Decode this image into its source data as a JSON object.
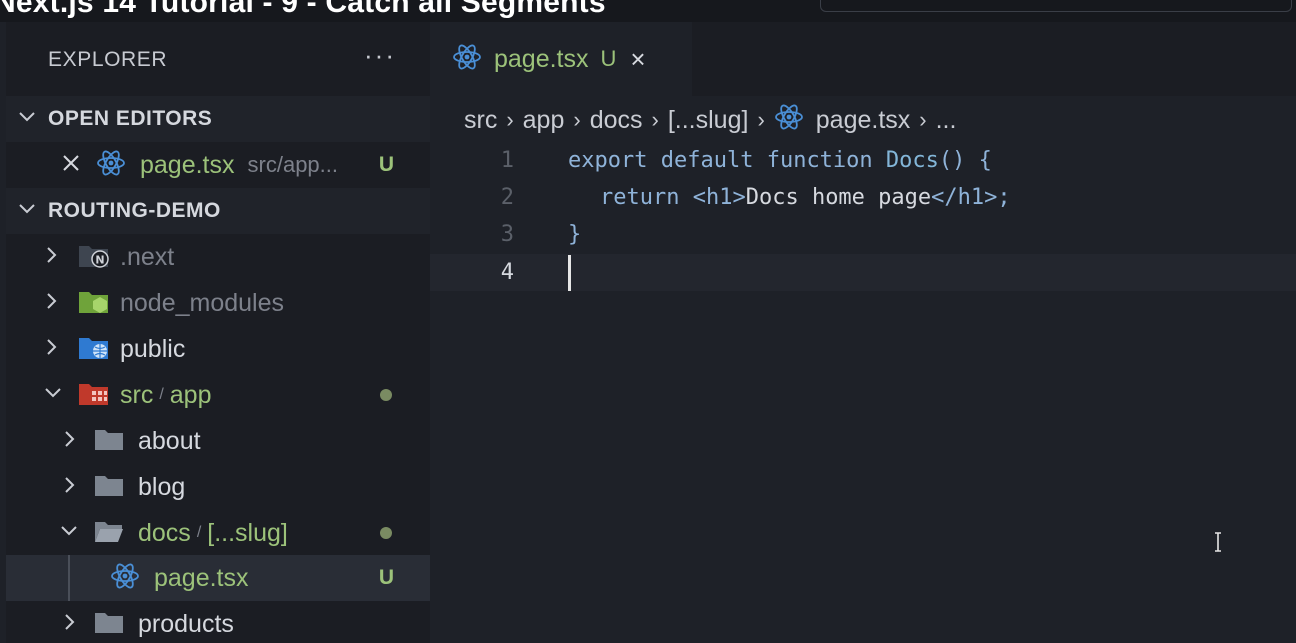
{
  "video_title": "Next.js 14 Tutorial - 9 - Catch all Segments",
  "sidebar": {
    "header": "EXPLORER",
    "more_label": "···",
    "open_editors": {
      "title": "OPEN EDITORS",
      "items": [
        {
          "name": "page.tsx",
          "path": "src/app...",
          "status": "U"
        }
      ]
    },
    "project": {
      "title": "ROUTING-DEMO",
      "items": [
        {
          "name": ".next"
        },
        {
          "name": "node_modules"
        },
        {
          "name": "public"
        },
        {
          "name_a": "src",
          "name_b": "app"
        },
        {
          "name": "about"
        },
        {
          "name": "blog"
        },
        {
          "name_a": "docs",
          "name_b": "[...slug]"
        },
        {
          "name": "page.tsx",
          "status": "U"
        },
        {
          "name": "products"
        }
      ]
    }
  },
  "editor": {
    "tab": {
      "name": "page.tsx",
      "status": "U",
      "close": "×"
    },
    "breadcrumb": [
      "src",
      "app",
      "docs",
      "[...slug]",
      "page.tsx",
      "..."
    ],
    "code": {
      "line_numbers": [
        "1",
        "2",
        "3",
        "4"
      ],
      "l1": {
        "kw1": "export",
        "kw2": "default",
        "kw3": "function",
        "fn": "Docs",
        "rest": "() {"
      },
      "l2": {
        "kw": "return",
        "open": "<h1>",
        "text": "Docs home page",
        "close": "</h1>;"
      },
      "l3": "}"
    }
  },
  "colors": {
    "untracked": "#9cc27a",
    "react_icon": "#4a8fd6",
    "background": "#1e2128"
  }
}
